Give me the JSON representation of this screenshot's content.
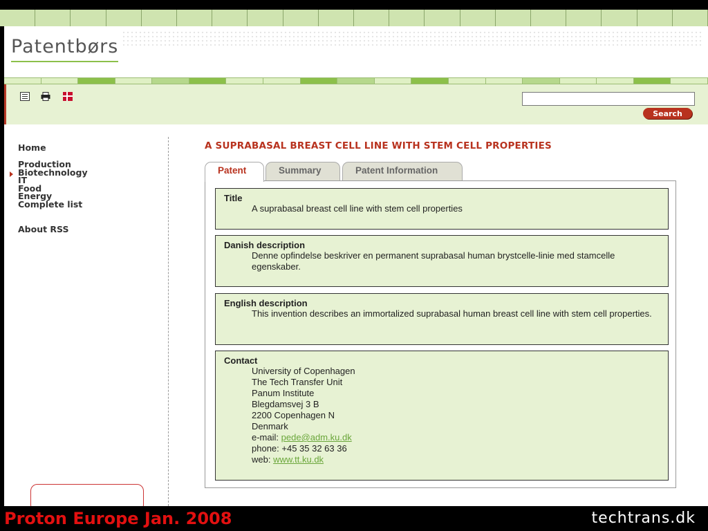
{
  "site": {
    "logo": "Patentbørs",
    "accent": "#b8321e",
    "green": "#e7f2d3"
  },
  "toolbar": {
    "icons": [
      "list-icon",
      "print-icon",
      "danish-flag-icon"
    ],
    "search_placeholder": "",
    "search_label": "Search"
  },
  "sidebar": {
    "home": "Home",
    "categories": [
      "Production",
      "Biotechnology",
      "IT",
      "Food",
      "Energy",
      "Complete list"
    ],
    "active": "Biotechnology",
    "about": "About RSS"
  },
  "main": {
    "heading": "A SUPRABASAL BREAST CELL LINE WITH STEM CELL PROPERTIES",
    "tabs": [
      "Patent",
      "Summary",
      "Patent Information"
    ],
    "active_tab": "Patent",
    "title_label": "Title",
    "title_text": "A suprabasal breast cell line with stem cell properties",
    "danish_label": "Danish description",
    "danish_text": "Denne opfindelse beskriver en permanent suprabasal human brystcelle-linie med stamcelle egenskaber.",
    "english_label": "English description",
    "english_text": "This invention describes an immortalized suprabasal human breast cell line with stem cell properties.",
    "contact_label": "Contact",
    "contact_lines": [
      "University of Copenhagen",
      "The Tech Transfer Unit",
      "Panum Institute",
      "Blegdamsvej 3 B",
      "2200 Copenhagen N",
      "Denmark"
    ],
    "email_prefix": "e-mail:",
    "email": "pede@adm.ku.dk",
    "phone": "phone: +45 35 32 63 36",
    "web_prefix": "web:",
    "web": "www.tt.ku.dk"
  },
  "footer": {
    "left": "Proton Europe Jan. 2008",
    "right": "techtrans.dk"
  }
}
